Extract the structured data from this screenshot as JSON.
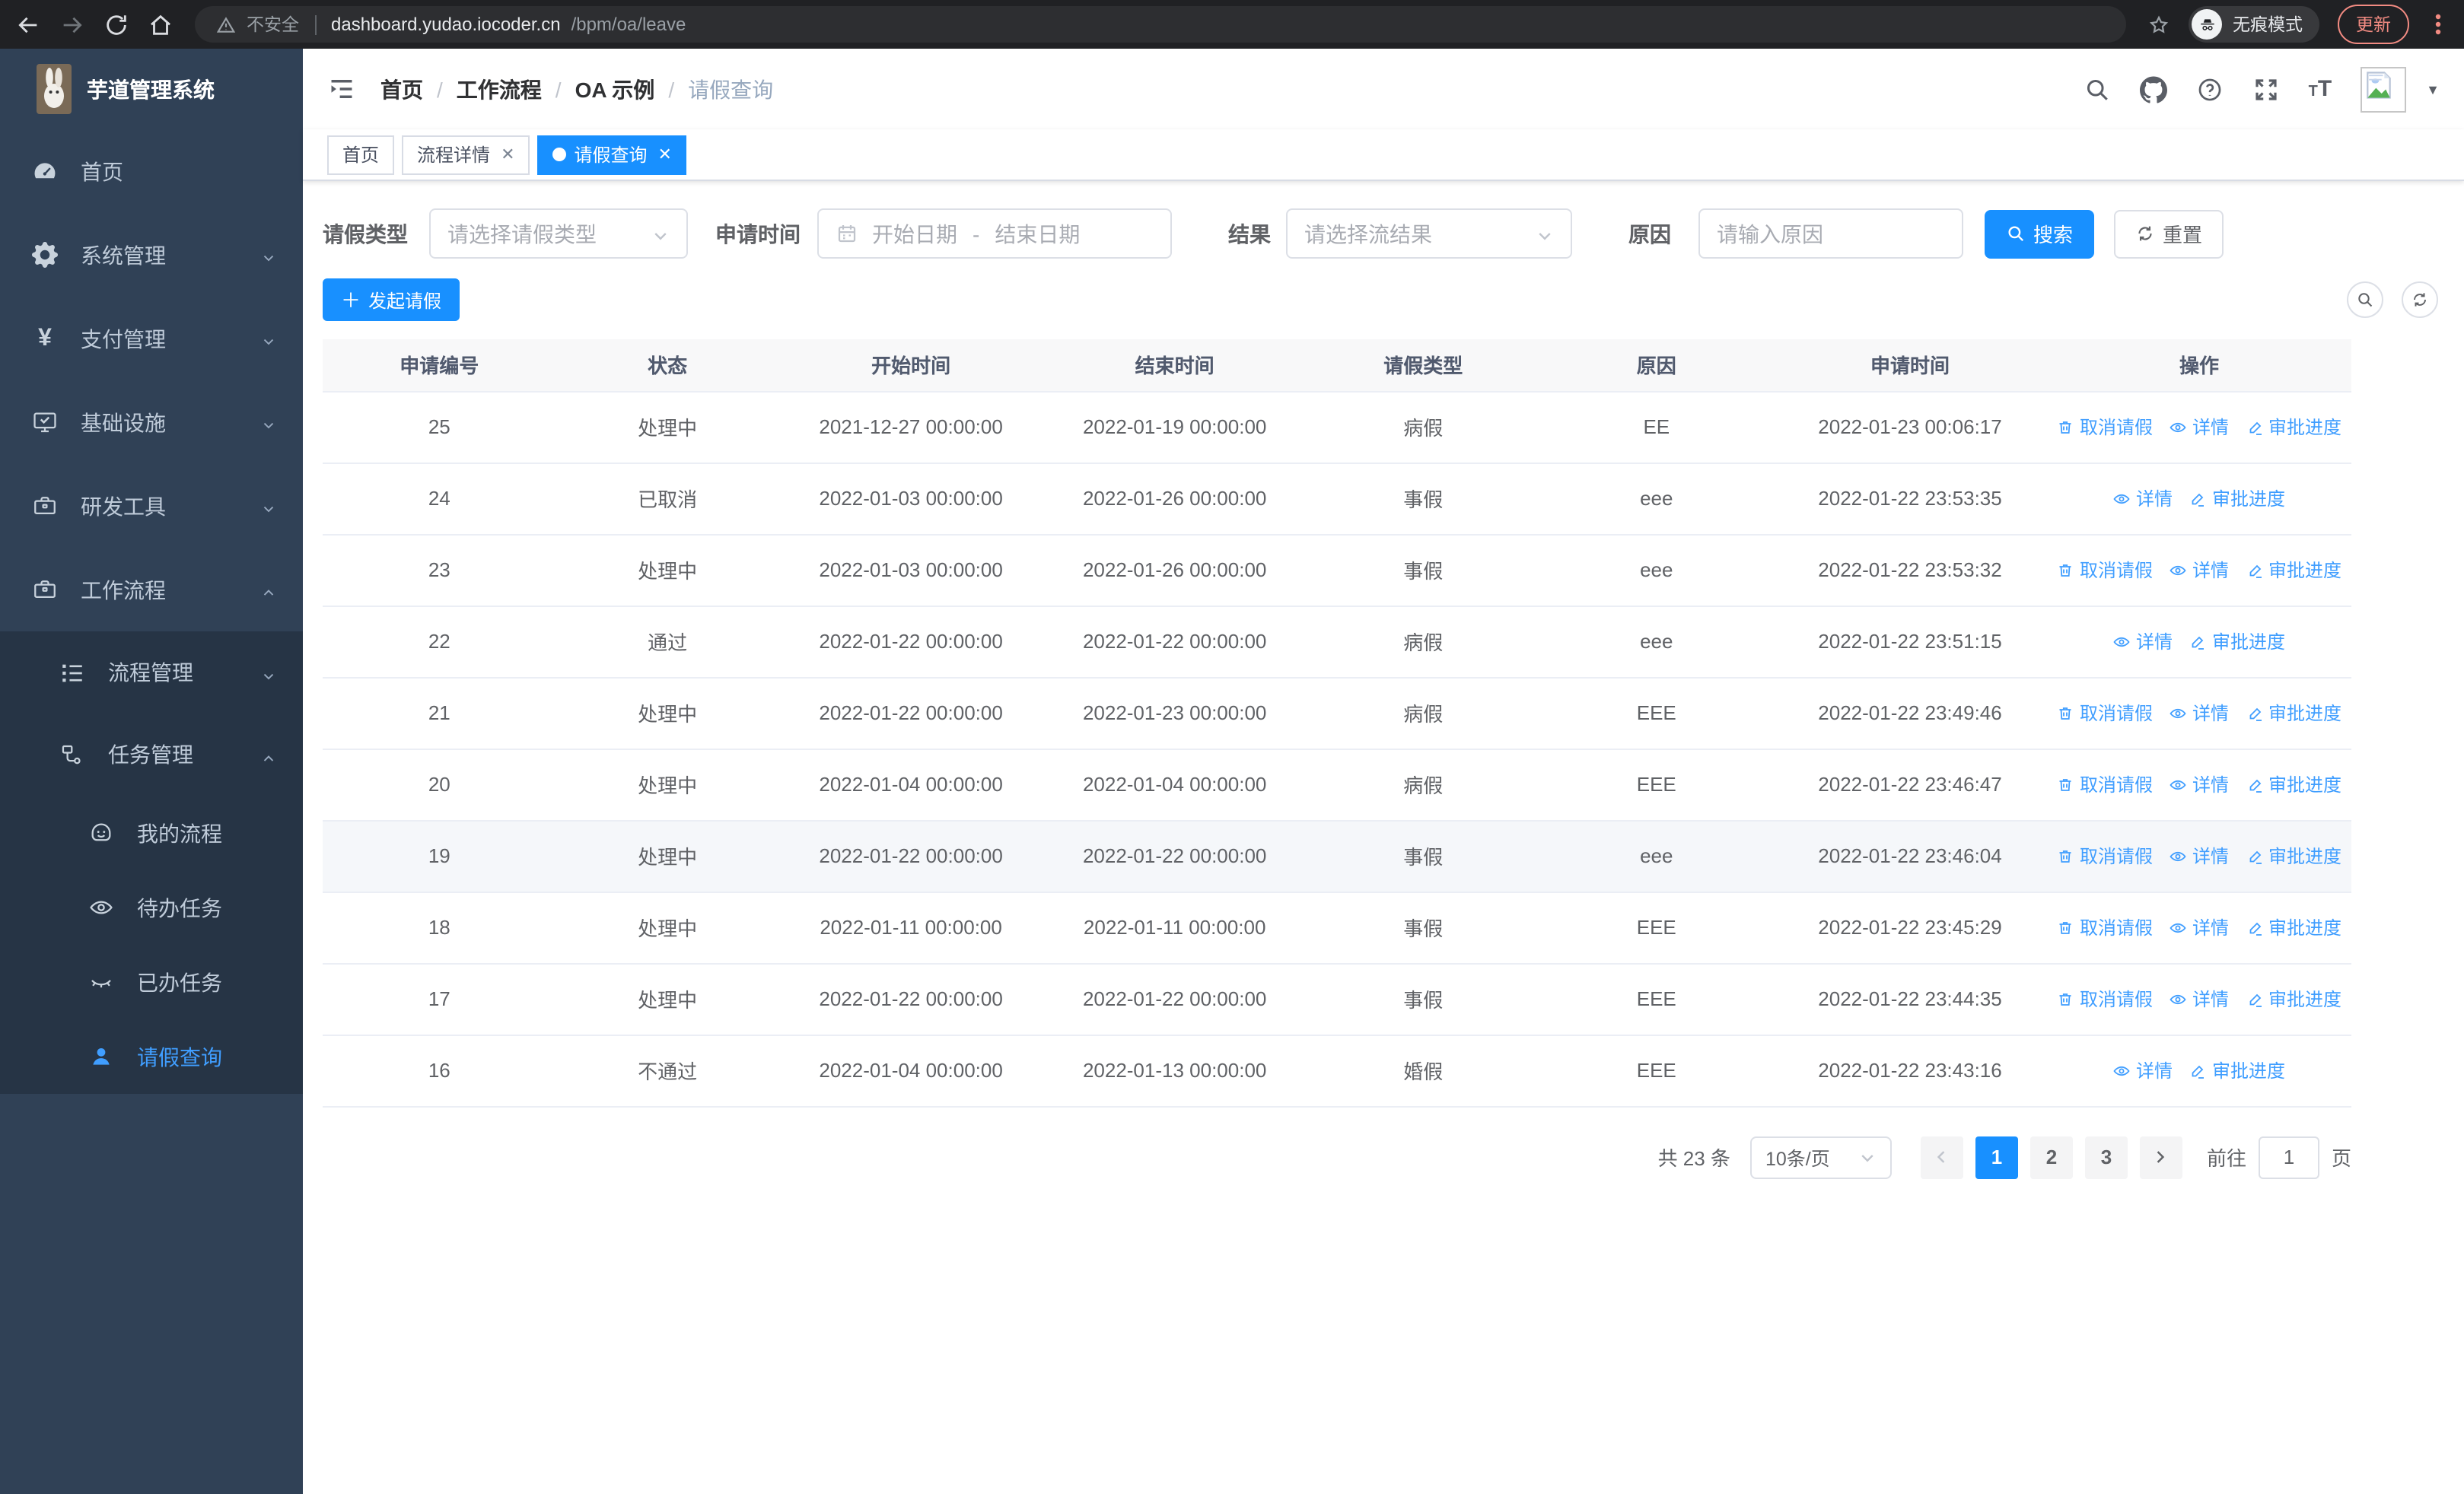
{
  "browser": {
    "security_label": "不安全",
    "url_host": "dashboard.yudao.iocoder.cn",
    "url_path": "/bpm/oa/leave",
    "incognito_label": "无痕模式",
    "update_label": "更新"
  },
  "sidebar": {
    "app_title": "芋道管理系统",
    "menu": [
      {
        "label": "首页",
        "icon": "dashboard-icon",
        "level": 1,
        "arrow": null,
        "sub": false,
        "active": false
      },
      {
        "label": "系统管理",
        "icon": "gear-icon",
        "level": 1,
        "arrow": "down",
        "sub": false,
        "active": false
      },
      {
        "label": "支付管理",
        "icon": "yen-icon",
        "level": 1,
        "arrow": "down",
        "sub": false,
        "active": false
      },
      {
        "label": "基础设施",
        "icon": "monitor-icon",
        "level": 1,
        "arrow": "down",
        "sub": false,
        "active": false
      },
      {
        "label": "研发工具",
        "icon": "toolbox-icon",
        "level": 1,
        "arrow": "down",
        "sub": false,
        "active": false
      },
      {
        "label": "工作流程",
        "icon": "briefcase-icon",
        "level": 1,
        "arrow": "up",
        "sub": false,
        "active": false
      },
      {
        "label": "流程管理",
        "icon": "list-icon",
        "level": 2,
        "arrow": "down",
        "sub": true,
        "active": false
      },
      {
        "label": "任务管理",
        "icon": "flow-icon",
        "level": 2,
        "arrow": "up",
        "sub": true,
        "active": false
      },
      {
        "label": "我的流程",
        "icon": "face-icon",
        "level": 3,
        "arrow": null,
        "sub": true,
        "active": false
      },
      {
        "label": "待办任务",
        "icon": "eye-open-icon",
        "level": 3,
        "arrow": null,
        "sub": true,
        "active": false
      },
      {
        "label": "已办任务",
        "icon": "eye-closed-icon",
        "level": 3,
        "arrow": null,
        "sub": true,
        "active": false
      },
      {
        "label": "请假查询",
        "icon": "user-icon",
        "level": 3,
        "arrow": null,
        "sub": true,
        "active": true
      }
    ]
  },
  "header": {
    "breadcrumb": [
      "首页",
      "工作流程",
      "OA 示例",
      "请假查询"
    ]
  },
  "tabs": [
    {
      "label": "首页",
      "closable": false,
      "active": false
    },
    {
      "label": "流程详情",
      "closable": true,
      "active": false
    },
    {
      "label": "请假查询",
      "closable": true,
      "active": true
    }
  ],
  "filters": {
    "leave_type_label": "请假类型",
    "leave_type_placeholder": "请选择请假类型",
    "apply_time_label": "申请时间",
    "start_date_placeholder": "开始日期",
    "range_separator": "-",
    "end_date_placeholder": "结束日期",
    "result_label": "结果",
    "result_placeholder": "请选择流结果",
    "reason_label": "原因",
    "reason_placeholder": "请输入原因",
    "search_label": "搜索",
    "reset_label": "重置"
  },
  "toolbar": {
    "create_label": "发起请假"
  },
  "table": {
    "columns": [
      "申请编号",
      "状态",
      "开始时间",
      "结束时间",
      "请假类型",
      "原因",
      "申请时间",
      "操作"
    ],
    "action_labels": {
      "cancel": "取消请假",
      "detail": "详情",
      "progress": "审批进度"
    },
    "rows": [
      {
        "id": "25",
        "status": "处理中",
        "start": "2021-12-27 00:00:00",
        "end": "2022-01-19 00:00:00",
        "type": "病假",
        "reason": "EE",
        "applied": "2022-01-23 00:06:17",
        "cancelable": true,
        "highlighted": false
      },
      {
        "id": "24",
        "status": "已取消",
        "start": "2022-01-03 00:00:00",
        "end": "2022-01-26 00:00:00",
        "type": "事假",
        "reason": "eee",
        "applied": "2022-01-22 23:53:35",
        "cancelable": false,
        "highlighted": false
      },
      {
        "id": "23",
        "status": "处理中",
        "start": "2022-01-03 00:00:00",
        "end": "2022-01-26 00:00:00",
        "type": "事假",
        "reason": "eee",
        "applied": "2022-01-22 23:53:32",
        "cancelable": true,
        "highlighted": false
      },
      {
        "id": "22",
        "status": "通过",
        "start": "2022-01-22 00:00:00",
        "end": "2022-01-22 00:00:00",
        "type": "病假",
        "reason": "eee",
        "applied": "2022-01-22 23:51:15",
        "cancelable": false,
        "highlighted": false
      },
      {
        "id": "21",
        "status": "处理中",
        "start": "2022-01-22 00:00:00",
        "end": "2022-01-23 00:00:00",
        "type": "病假",
        "reason": "EEE",
        "applied": "2022-01-22 23:49:46",
        "cancelable": true,
        "highlighted": false
      },
      {
        "id": "20",
        "status": "处理中",
        "start": "2022-01-04 00:00:00",
        "end": "2022-01-04 00:00:00",
        "type": "病假",
        "reason": "EEE",
        "applied": "2022-01-22 23:46:47",
        "cancelable": true,
        "highlighted": false
      },
      {
        "id": "19",
        "status": "处理中",
        "start": "2022-01-22 00:00:00",
        "end": "2022-01-22 00:00:00",
        "type": "事假",
        "reason": "eee",
        "applied": "2022-01-22 23:46:04",
        "cancelable": true,
        "highlighted": true
      },
      {
        "id": "18",
        "status": "处理中",
        "start": "2022-01-11 00:00:00",
        "end": "2022-01-11 00:00:00",
        "type": "事假",
        "reason": "EEE",
        "applied": "2022-01-22 23:45:29",
        "cancelable": true,
        "highlighted": false
      },
      {
        "id": "17",
        "status": "处理中",
        "start": "2022-01-22 00:00:00",
        "end": "2022-01-22 00:00:00",
        "type": "事假",
        "reason": "EEE",
        "applied": "2022-01-22 23:44:35",
        "cancelable": true,
        "highlighted": false
      },
      {
        "id": "16",
        "status": "不通过",
        "start": "2022-01-04 00:00:00",
        "end": "2022-01-13 00:00:00",
        "type": "婚假",
        "reason": "EEE",
        "applied": "2022-01-22 23:43:16",
        "cancelable": false,
        "highlighted": false
      }
    ]
  },
  "pagination": {
    "total_text": "共 23 条",
    "page_size": "10条/页",
    "pages": [
      "1",
      "2",
      "3"
    ],
    "active_page": "1",
    "goto_label": "前往",
    "goto_value": "1",
    "goto_unit": "页"
  },
  "colors": {
    "primary": "#1890ff",
    "link": "#409eff",
    "sidebar_bg": "#304156",
    "sidebar_submenu_bg": "#263445",
    "sidebar_text": "#bfcbd9",
    "highlight_row_bg": "#f5f7fa",
    "table_header_bg": "#f8f8f9",
    "chrome_bg": "#202124",
    "update_accent": "#f28b82"
  }
}
